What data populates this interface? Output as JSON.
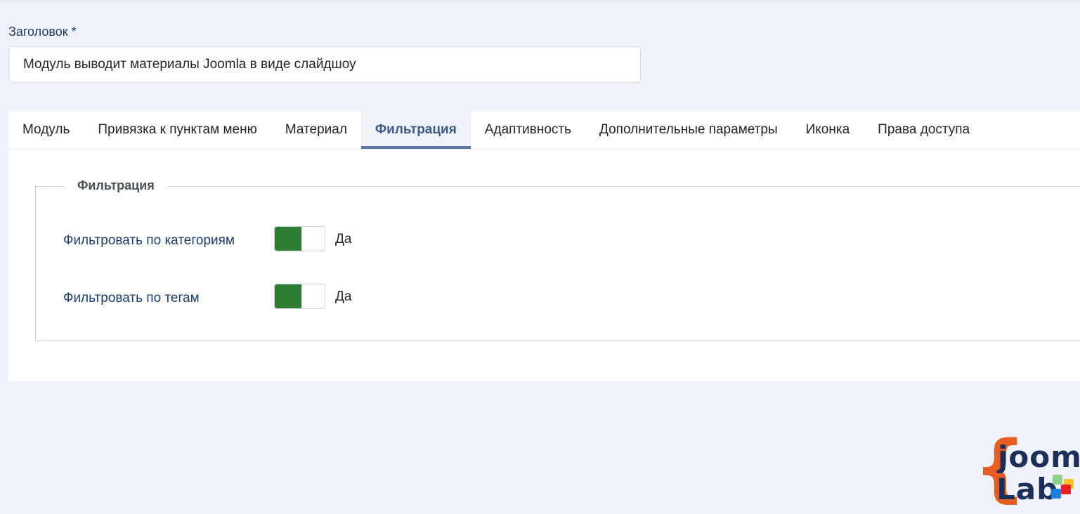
{
  "form": {
    "title_label": "Заголовок *",
    "title_value": "Модуль выводит материалы Joomla в виде слайдшоу"
  },
  "tabs": [
    {
      "label": "Модуль",
      "active": false
    },
    {
      "label": "Привязка к пунктам меню",
      "active": false
    },
    {
      "label": "Материал",
      "active": false
    },
    {
      "label": "Фильтрация",
      "active": true
    },
    {
      "label": "Адаптивность",
      "active": false
    },
    {
      "label": "Дополнительные параметры",
      "active": false
    },
    {
      "label": "Иконка",
      "active": false
    },
    {
      "label": "Права доступа",
      "active": false
    }
  ],
  "fieldset": {
    "legend": "Фильтрация",
    "rows": [
      {
        "label": "Фильтровать по категориям",
        "value": "Да",
        "on": true
      },
      {
        "label": "Фильтровать по тегам",
        "value": "Да",
        "on": true
      }
    ]
  },
  "colors": {
    "background": "#eff2fb",
    "toggle_on": "#2e7d32",
    "active_tab": "#3d5a86",
    "logo_orange": "#e85d22",
    "logo_navy": "#1c2f5a"
  },
  "logo": {
    "line1": "joom",
    "line2": "Lab",
    "brace": "{"
  }
}
